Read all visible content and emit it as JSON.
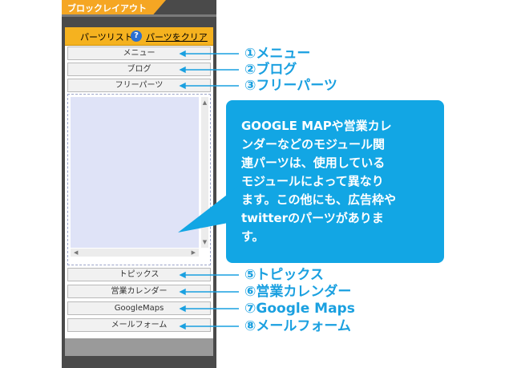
{
  "panel": {
    "tab_title": "ブロックレイアウト",
    "toolbar": {
      "parts_list": "パーツリスト",
      "help_icon": "?",
      "clear_link": "パーツをクリア"
    },
    "items_top": [
      "メニュー",
      "ブログ",
      "フリーパーツ"
    ],
    "items_bottom": [
      "トピックス",
      "営業カレンダー",
      "GoogleMaps",
      "メールフォーム"
    ]
  },
  "labels": [
    "①メニュー",
    "②ブログ",
    "③フリーパーツ",
    "⑤トピックス",
    "⑥営業カレンダー",
    "⑦Google Maps",
    "⑧メールフォーム"
  ],
  "callout": {
    "lines": [
      "GOOGLE MAPや営業カレ",
      "ンダーなどのモジュール関",
      "連パーツは、使用している",
      "モジュールによって異なり",
      "ます。この他にも、広告枠や",
      "twitterのパーツがありま",
      "す。"
    ]
  },
  "colors": {
    "accent_orange": "#f5a623",
    "label_blue": "#1aa0e0",
    "callout_blue": "#12a6e4",
    "panel_dark": "#4a4a4a"
  }
}
